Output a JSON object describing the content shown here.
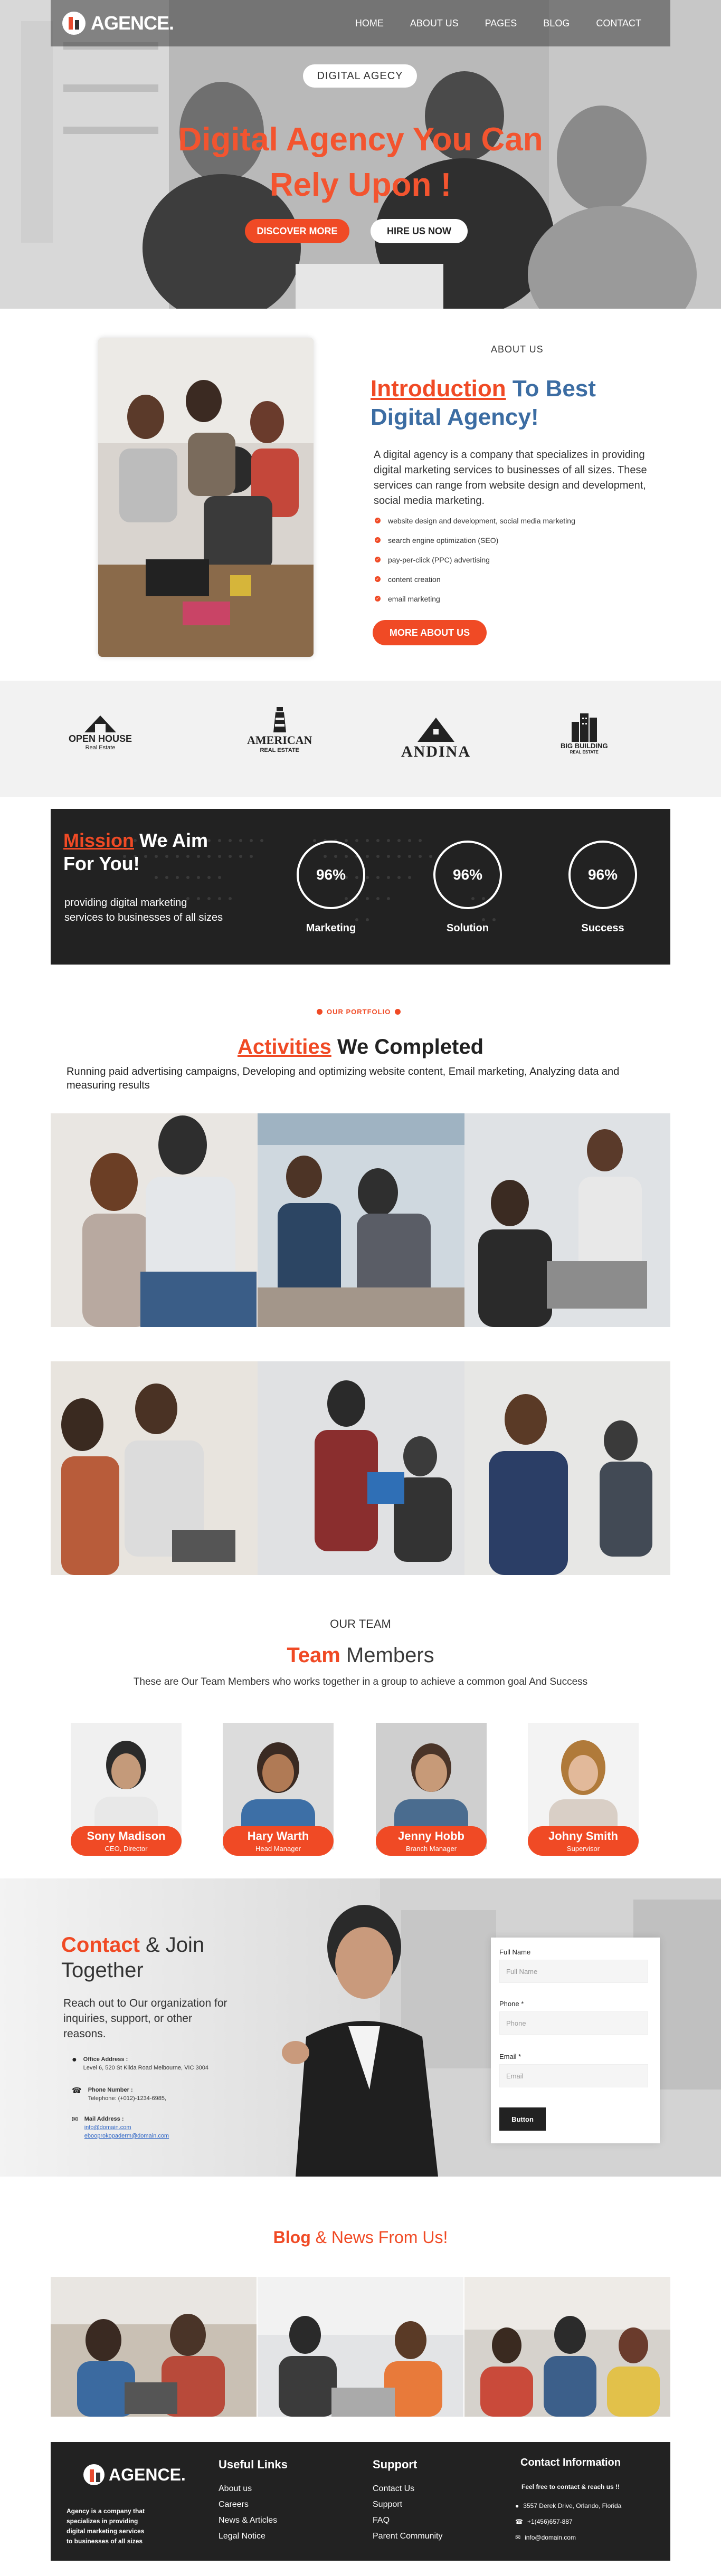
{
  "nav": {
    "brand": "AGENCE.",
    "links": [
      "HOME",
      "ABOUT US",
      "PAGES",
      "BLOG",
      "CONTACT"
    ]
  },
  "hero": {
    "pill": "DIGITAL AGECY",
    "title_line1": "Digital Agency You Can",
    "title_line2": "Rely Upon !",
    "btn_discover": "DISCOVER MORE",
    "btn_hire": "HIRE US NOW"
  },
  "about": {
    "label": "ABOUT US",
    "title_red": "Introduction",
    "title_rest1": " To Best",
    "title_rest2": "Digital Agency!",
    "paragraph": "A digital agency is a company that specializes in providing digital marketing services to businesses of all sizes. These services can range from website design and development, social media marketing.",
    "list": [
      "website design and development, social media marketing",
      "search engine optimization (SEO)",
      "pay-per-click (PPC) advertising",
      "content creation",
      "email marketing"
    ],
    "button": "MORE ABOUT US"
  },
  "clients": [
    {
      "name": "OPEN HOUSE",
      "sub": "Real Estate"
    },
    {
      "name": "AMERICAN",
      "sub": "REAL ESTATE"
    },
    {
      "name": "ANDINA",
      "sub": ""
    },
    {
      "name": "BIG BUILDING",
      "sub": "REAL ESTATE"
    }
  ],
  "mission": {
    "title_red": "Mission",
    "title_rest1": " We Aim",
    "title_rest2": "For You!",
    "text": "providing digital marketing services to businesses of all sizes",
    "stats": [
      {
        "value": "96%",
        "label": "Marketing"
      },
      {
        "value": "96%",
        "label": "Solution"
      },
      {
        "value": "96%",
        "label": "Success"
      }
    ]
  },
  "portfolio": {
    "label": "OUR PORTFOLIO",
    "title_red": "Activities",
    "title_rest": " We Completed",
    "text": "Running paid advertising campaigns, Developing and optimizing website content, Email marketing, Analyzing data and measuring results"
  },
  "team": {
    "label": "OUR TEAM",
    "title_red": "Team",
    "title_rest": " Members",
    "subtitle": "These are Our Team Members who works together in a group to achieve a common goal And Success",
    "members": [
      {
        "name": "Sony Madison",
        "role": "CEO, Director"
      },
      {
        "name": "Hary Warth",
        "role": "Head Manager"
      },
      {
        "name": "Jenny Hobb",
        "role": "Branch Manager"
      },
      {
        "name": "Johny Smith",
        "role": "Supervisor"
      }
    ]
  },
  "contact": {
    "title_red": "Contact",
    "title_rest1": " & Join",
    "title_rest2": "Together",
    "text": "Reach out to Our organization for inquiries, support, or other reasons.",
    "office_label": "Office Address :",
    "office_value": "Level 6, 520 St Kilda Road Melbourne, VIC 3004",
    "phone_label": "Phone Number :",
    "phone_value": "Telephone: (+012)-1234-6985,",
    "mail_label": "Mail Address :",
    "mail_value1": "info@domain.com",
    "mail_value2": "ebooprokopaderm@domain.com",
    "form": {
      "name_label": "Full Name",
      "name_placeholder": "Full Name",
      "phone_label": "Phone *",
      "phone_placeholder": "Phone",
      "email_label": "Email *",
      "email_placeholder": "Email",
      "button": "Button"
    }
  },
  "blog": {
    "title_red": "Blog",
    "title_rest": " & News From Us!"
  },
  "footer": {
    "brand": "AGENCE.",
    "about": "Agency is a company that specializes in providing digital marketing services to businesses of all sizes",
    "useful_title": "Useful Links",
    "useful_links": [
      "About us",
      "Careers",
      "News & Articles",
      "Legal Notice"
    ],
    "support_title": "Support",
    "support_links": [
      "Contact Us",
      "Support",
      "FAQ",
      "Parent Community"
    ],
    "contact_title": "Contact Information",
    "contact_intro": "Feel free to contact & reach us !!",
    "address": "3557 Derek Drive, Orlando, Florida",
    "phone": "+1(456)657-887",
    "email": "info@domain.com"
  },
  "colors": {
    "accent": "#f04a25",
    "blue": "#3c6da3",
    "dark": "#222222"
  }
}
